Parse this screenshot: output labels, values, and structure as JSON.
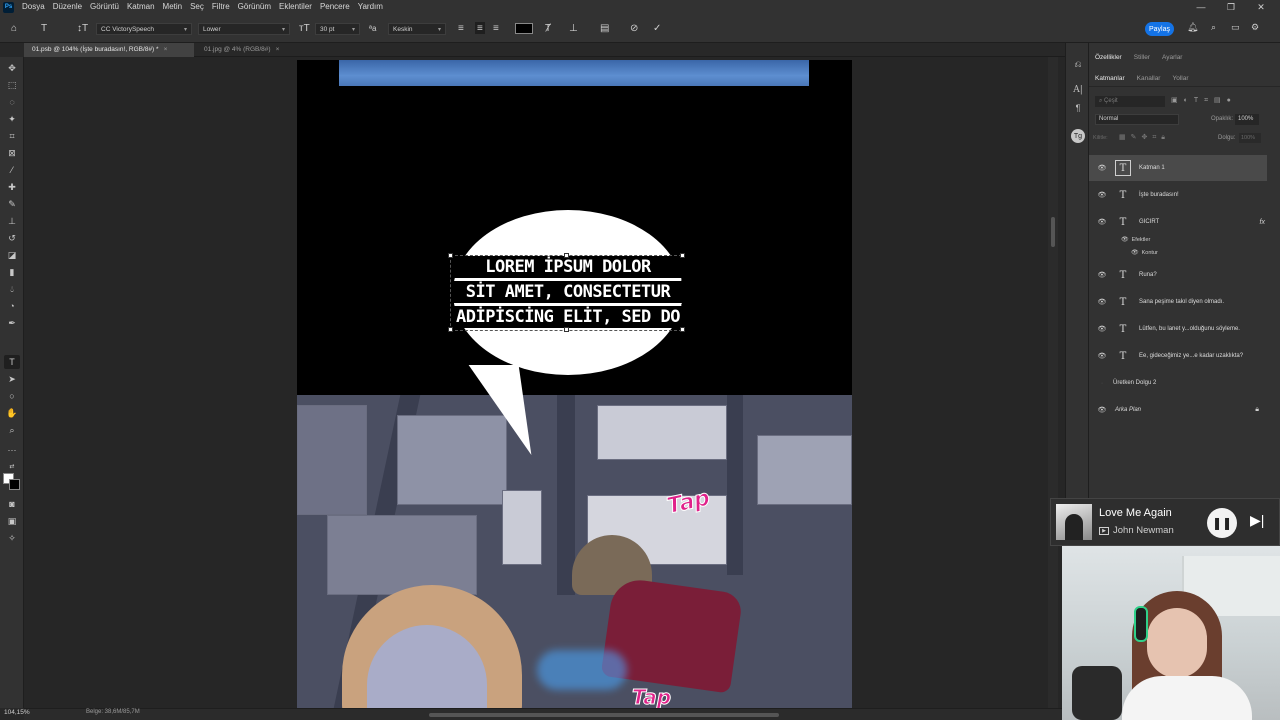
{
  "menu": {
    "items": [
      "Dosya",
      "Düzenle",
      "Görüntü",
      "Katman",
      "Metin",
      "Seç",
      "Filtre",
      "Görünüm",
      "Eklentiler",
      "Pencere",
      "Yardım"
    ]
  },
  "options": {
    "font_family": "CC VictorySpeech",
    "font_style": "Lower",
    "font_size": "30 pt",
    "antialias": "Keskin",
    "text_color": "#000000",
    "share_label": "Paylaş"
  },
  "tabs": {
    "active": "01.psb @ 104% (İşte buradasın!, RGB/8#) *",
    "inactive": "01.jpg @ 4% (RGB/8#)"
  },
  "canvas": {
    "text_lines": [
      "LOREM İPSUM DOLOR",
      "SİT AMET, CONSECTETUR",
      "ADİPİSCİNG ELİT, SED DO"
    ],
    "sfx_1": "Tap",
    "sfx_2": "Tap"
  },
  "status": {
    "zoom": "104,15%",
    "doc": "Belge: 38,6M/85,7M"
  },
  "panels": {
    "top_tabs": [
      "Özellikler",
      "Stiller",
      "Ayarlar"
    ],
    "layer_tabs": [
      "Katmanlar",
      "Kanallar",
      "Yollar"
    ],
    "search_placeholder": "Çeşit",
    "blend_mode": "Normal",
    "opacity_label": "Opaklık:",
    "opacity_value": "100%",
    "lock_label": "Kilitle:",
    "fill_label": "Dolgu:",
    "fill_value": "100%",
    "layers": [
      {
        "name": "Katman 1",
        "type": "text",
        "selected": true
      },
      {
        "name": "İşte buradasın!",
        "type": "text"
      },
      {
        "name": "GICIRT",
        "type": "text",
        "fx": "fx"
      },
      {
        "name": "Runa?",
        "type": "text"
      },
      {
        "name": "Sana peşime takıl diyen olmadı.",
        "type": "text"
      },
      {
        "name": "Lütfen, bu lanet y...olduğunu söyleme.",
        "type": "text"
      },
      {
        "name": "Ee, gideceğimiz ye...e kadar uzaklıkta?",
        "type": "text"
      },
      {
        "name": "Üretken Dolgu 2",
        "type": "fill"
      },
      {
        "name": "Arka Plan",
        "type": "bg"
      }
    ],
    "effects_label": "Efektler",
    "stroke_label": "Kontur"
  },
  "media": {
    "title": "Love Me Again",
    "artist": "John Newman"
  }
}
